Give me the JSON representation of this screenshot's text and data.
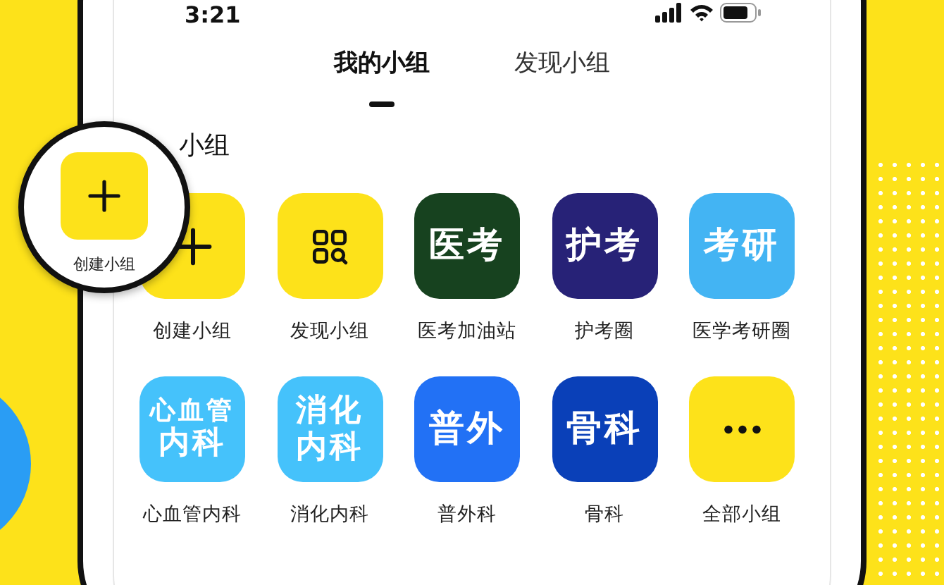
{
  "status_bar": {
    "time": "3:21"
  },
  "tabs": [
    {
      "label": "我的小组",
      "selected": true
    },
    {
      "label": "发现小组",
      "selected": false
    }
  ],
  "section_title": "小组",
  "groups": [
    {
      "label": "创建小组",
      "kind": "plus",
      "color": "#fde21a"
    },
    {
      "label": "发现小组",
      "kind": "discover",
      "color": "#fde21a"
    },
    {
      "label": "医考加油站",
      "kind": "text",
      "tile_lines": [
        "医考"
      ],
      "color": "#17421f"
    },
    {
      "label": "护考圈",
      "kind": "text",
      "tile_lines": [
        "护考"
      ],
      "color": "#272277"
    },
    {
      "label": "医学考研圈",
      "kind": "text",
      "tile_lines": [
        "考研"
      ],
      "color": "#43b4f3"
    },
    {
      "label": "心血管内科",
      "kind": "text",
      "tile_lines": [
        "心血管",
        "内科"
      ],
      "color": "#45c2fb"
    },
    {
      "label": "消化内科",
      "kind": "text",
      "tile_lines": [
        "消化",
        "内科"
      ],
      "color": "#45c2fb"
    },
    {
      "label": "普外科",
      "kind": "text",
      "tile_lines": [
        "普外"
      ],
      "color": "#2271f5"
    },
    {
      "label": "骨科",
      "kind": "text",
      "tile_lines": [
        "骨科"
      ],
      "color": "#0a40b8"
    },
    {
      "label": "全部小组",
      "kind": "more",
      "color": "#fde21a"
    }
  ],
  "magnifier": {
    "label": "创建小组",
    "kind": "plus"
  }
}
